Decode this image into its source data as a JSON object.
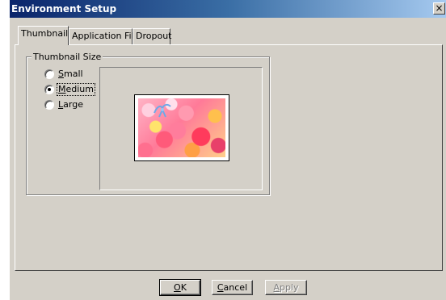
{
  "window": {
    "title": "Environment Setup",
    "close_glyph": "×"
  },
  "tabs": [
    {
      "label": "Thumbnail",
      "active": true
    },
    {
      "label": "Application File",
      "active": false
    },
    {
      "label": "Dropout",
      "active": false
    }
  ],
  "thumbnail_size": {
    "group_title": "Thumbnail Size",
    "options": [
      {
        "label": "Small",
        "mnemonic": "S",
        "rest": "mall",
        "checked": false
      },
      {
        "label": "Medium",
        "mnemonic": "M",
        "rest": "edium",
        "checked": true
      },
      {
        "label": "Large",
        "mnemonic": "L",
        "rest": "arge",
        "checked": false
      }
    ]
  },
  "buttons": {
    "ok": {
      "label": "OK",
      "mnemonic": "O",
      "rest": "K"
    },
    "cancel": {
      "label": "Cancel",
      "mnemonic": "C",
      "rest": "ancel"
    },
    "apply": {
      "label": "Apply",
      "mnemonic": "A",
      "rest": "pply",
      "enabled": false
    }
  },
  "colors": {
    "titlebar_start": "#0a246a",
    "titlebar_end": "#a6caf0",
    "face": "#d4d0c8"
  }
}
